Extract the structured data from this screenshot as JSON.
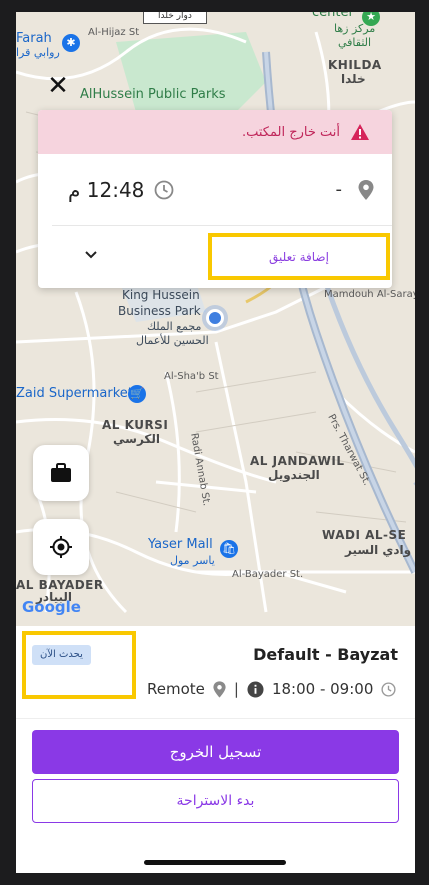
{
  "map": {
    "labels": {
      "top_sign": "دوار خلدا",
      "farah": "Farah",
      "farah_ar": "روابي قرا",
      "al_hijaz": "Al-Hijaz St",
      "center": "center",
      "center_ar1": "مركز زها",
      "center_ar2": "الثقافي",
      "khilda": "KHILDA",
      "khilda_ar": "خلدا",
      "park": "AlHussein Public Parks",
      "meca": "Mec",
      "mamdouh": "Mamdouh Al-Saraym",
      "khbp1": "King Hussein",
      "khbp2": "Business Park",
      "khbp_ar1": "مجمع الملك",
      "khbp_ar2": "الحسين للأعمال",
      "zaid": "Zaid Supermarket",
      "al_shab": "Al-Sha'b St",
      "al_kursi": "AL KURSI",
      "al_kursi_ar": "الكرسي",
      "radi_annab": "Radi Annab St.",
      "jandawil": "AL JANDAWIL",
      "jandawil_ar": "الجندويل",
      "tharwat": "Prs. Tharwat St.",
      "wadi": "WADI AL-SE",
      "wadi_ar": "وادي السير",
      "yaser": "Yaser Mall",
      "yaser_ar": "ياسر مول",
      "al_bayader_st": "Al-Bayader St.",
      "al_bayader": "AL BAYADER",
      "al_bayader_ar": "البيادر",
      "google": "Google"
    }
  },
  "close_icon_glyph": "✕",
  "card": {
    "alert_text": "أنت خارج المكتب.",
    "time_value": "12:48 م",
    "location_value": "-",
    "add_comment_label": "إضافة تعليق"
  },
  "bottom": {
    "badge": "يحدث الآن",
    "shift_title": "Default - Bayzat",
    "work_type": "Remote",
    "separator": "|",
    "hours": "18:00 - 09:00",
    "checkout_label": "تسجيل الخروج",
    "break_label": "بدء الاستراحة"
  },
  "colors": {
    "accent": "#8a39e6",
    "alert_bg": "#f6d4de",
    "alert_text": "#c0265a",
    "highlight": "#f9c800",
    "badge_bg": "#cfe0f7"
  }
}
